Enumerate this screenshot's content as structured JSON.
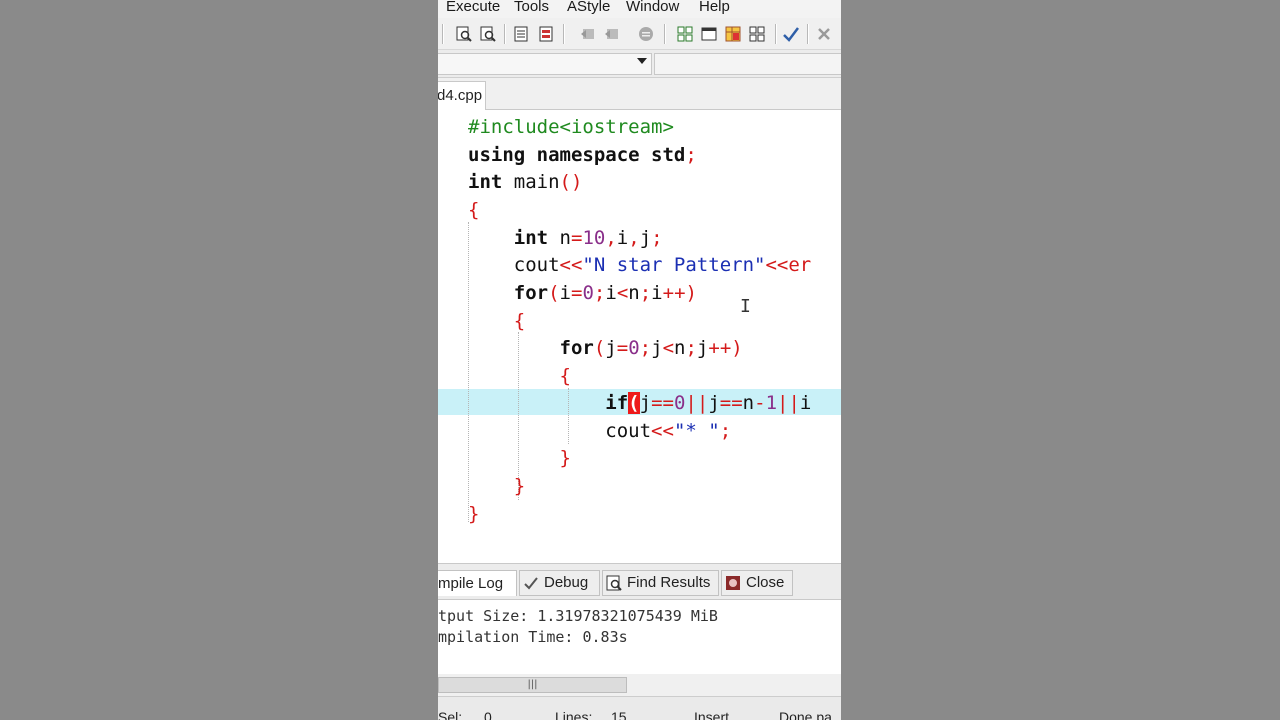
{
  "menu": {
    "items": [
      "Execute",
      "Tools",
      "AStyle",
      "Window",
      "Help"
    ]
  },
  "toolbar": {
    "icons": [
      "print-preview-icon",
      "print-preview-2-icon",
      "toggle-bookmark-icon",
      "goto-bookmark-icon",
      "indent-icon",
      "unindent-icon",
      "comment-icon",
      "tile-windows-icon",
      "single-window-icon",
      "class-browser-icon",
      "project-view-icon",
      "syntax-check-icon",
      "close-file-icon"
    ]
  },
  "file_tab": {
    "label": "d4.cpp"
  },
  "code": {
    "l1": "#include<iostream>",
    "l2_kw": "using namespace",
    "l2_rest": " std",
    "l3_kw": "int",
    "l3_rest": " main",
    "l5_kw": "int",
    "l5_n": " n",
    "l5_val": "10",
    "l5_vars": "i",
    "l5_vars2": "j",
    "l6_kw": "cout",
    "l6_str": "\"N star Pattern\"",
    "l6_tail": "<<er",
    "l7_kw": "for",
    "l9_kw": "for",
    "l11_kw": "if",
    "l12_kw": "cout",
    "l12_str": "\"* \""
  },
  "panel_tabs": {
    "compile_log": "mpile Log",
    "debug": "Debug",
    "find_results": "Find Results",
    "close": "Close"
  },
  "output": {
    "line1": "tput Size: 1.31978321075439 MiB",
    "line2": "mpilation Time: 0.83s"
  },
  "status": {
    "sel_label": "Sel:",
    "sel_value": "0",
    "lines_label": "Lines:",
    "lines_value": "15",
    "mode": "Insert",
    "message": "Done pa"
  }
}
